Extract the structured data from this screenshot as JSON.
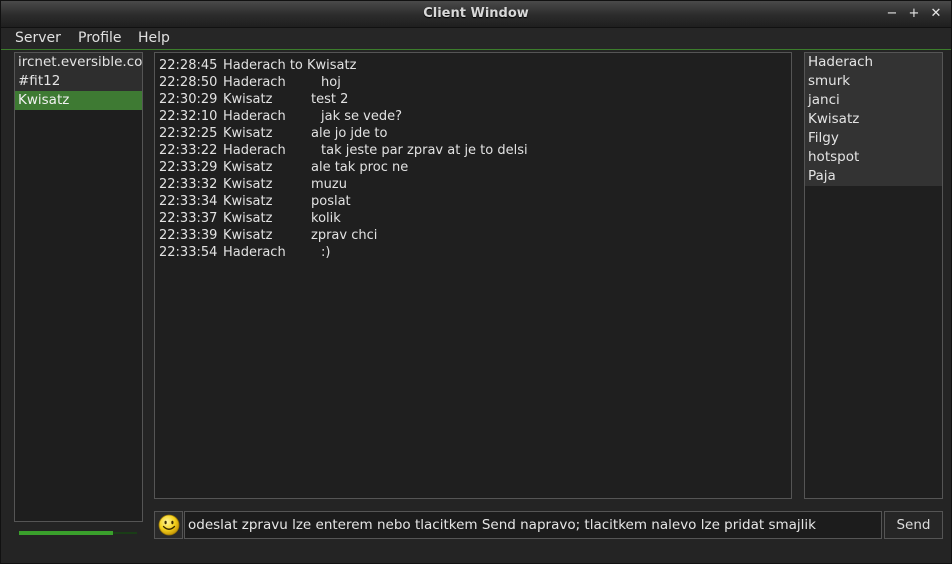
{
  "window": {
    "title": "Client Window",
    "minimize_glyph": "−",
    "maximize_glyph": "+",
    "close_glyph": "✕"
  },
  "menu": {
    "server": "Server",
    "profile": "Profile",
    "help": "Help"
  },
  "channels": [
    {
      "label": "ircnet.eversible.co",
      "selected": false
    },
    {
      "label": "#fit12",
      "selected": false
    },
    {
      "label": "Kwisatz",
      "selected": true
    }
  ],
  "progress": {
    "value": 0.8
  },
  "messages": [
    {
      "time": "22:28:45",
      "nick": "Haderach to Kwisatz",
      "text": ""
    },
    {
      "time": "22:28:50",
      "nick": "Haderach",
      "text": "hoj"
    },
    {
      "time": "22:30:29",
      "nick": "Kwisatz",
      "text": "test 2"
    },
    {
      "time": "22:32:10",
      "nick": "Haderach",
      "text": "jak se vede?"
    },
    {
      "time": "22:32:25",
      "nick": "Kwisatz",
      "text": "ale jo jde to"
    },
    {
      "time": "22:33:22",
      "nick": "Haderach",
      "text": "tak jeste par zprav at je to delsi"
    },
    {
      "time": "22:33:29",
      "nick": "Kwisatz",
      "text": "ale tak proc ne"
    },
    {
      "time": "22:33:32",
      "nick": "Kwisatz",
      "text": "muzu"
    },
    {
      "time": "22:33:34",
      "nick": "Kwisatz",
      "text": "poslat"
    },
    {
      "time": "22:33:37",
      "nick": "Kwisatz",
      "text": "kolik"
    },
    {
      "time": "22:33:39",
      "nick": "Kwisatz",
      "text": "zprav chci"
    },
    {
      "time": "22:33:54",
      "nick": "Haderach",
      "text": ":)"
    }
  ],
  "users": [
    "Haderach",
    "smurk",
    "janci",
    "Kwisatz",
    "Filgy",
    "hotspot",
    "Paja"
  ],
  "input": {
    "value": "odeslat zpravu lze enterem nebo tlacitkem Send napravo; tlacitkem nalevo lze pridat smajlik",
    "placeholder": ""
  },
  "buttons": {
    "send": "Send",
    "smiley_icon": "smiley-face"
  },
  "colors": {
    "accent": "#3e7a33",
    "progress": "#3aa02c",
    "smiley": "#f5d21c"
  }
}
